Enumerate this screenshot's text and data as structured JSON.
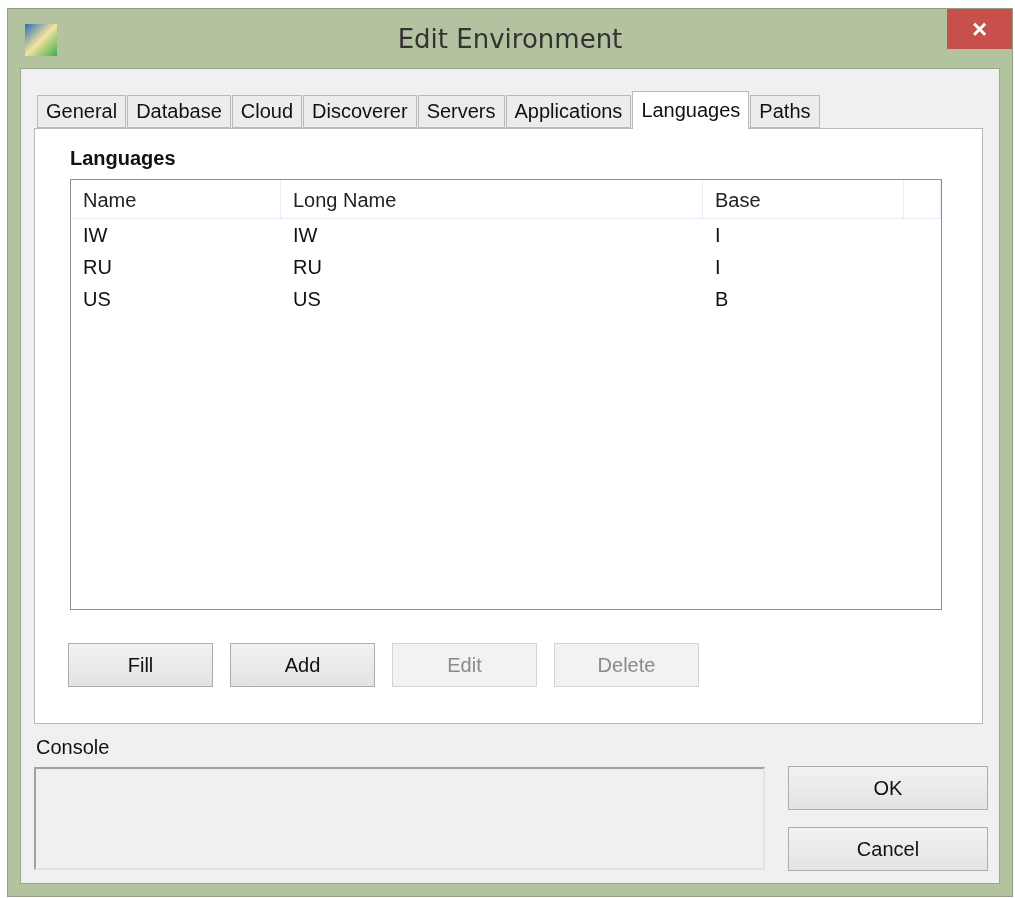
{
  "window": {
    "title": "Edit Environment",
    "close": "×"
  },
  "tabs": [
    {
      "label": "General",
      "selected": false
    },
    {
      "label": "Database",
      "selected": false
    },
    {
      "label": "Cloud",
      "selected": false
    },
    {
      "label": "Discoverer",
      "selected": false
    },
    {
      "label": "Servers",
      "selected": false
    },
    {
      "label": "Applications",
      "selected": false
    },
    {
      "label": "Languages",
      "selected": true
    },
    {
      "label": "Paths",
      "selected": false
    }
  ],
  "section_title": "Languages",
  "table": {
    "columns": [
      "Name",
      "Long Name",
      "Base"
    ],
    "rows": [
      [
        "IW",
        "IW",
        "I"
      ],
      [
        "RU",
        "RU",
        "I"
      ],
      [
        "US",
        "US",
        "B"
      ]
    ]
  },
  "table_buttons": [
    {
      "label": "Fill",
      "disabled": false
    },
    {
      "label": "Add",
      "disabled": false
    },
    {
      "label": "Edit",
      "disabled": true
    },
    {
      "label": "Delete",
      "disabled": true
    }
  ],
  "console": {
    "label": "Console"
  },
  "dialog_buttons": [
    "OK",
    "Cancel"
  ]
}
